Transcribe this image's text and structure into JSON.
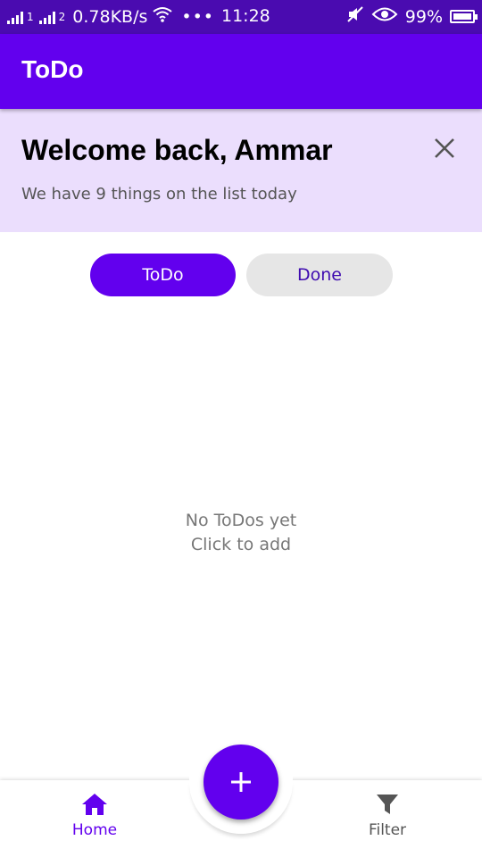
{
  "status_bar": {
    "sim1": "1",
    "sim2": "2",
    "speed": "0.78KB/s",
    "dots": "•••",
    "time": "11:28",
    "battery": "99%"
  },
  "app_bar": {
    "title": "ToDo"
  },
  "banner": {
    "title": "Welcome back, Ammar",
    "subtitle": "We have 9 things on the list today"
  },
  "toggle": {
    "todo_label": "ToDo",
    "done_label": "Done",
    "selected": "ToDo"
  },
  "empty_state": {
    "line1": "No ToDos yet",
    "line2": "Click to add"
  },
  "bottom_nav": {
    "home_label": "Home",
    "filter_label": "Filter",
    "active": "Home"
  },
  "fab": {
    "icon": "plus-icon"
  },
  "colors": {
    "primary": "#6200ee",
    "status_bar": "#4a0bb0",
    "banner_bg": "#ebdefd",
    "done_bg": "#e6e6e6"
  }
}
